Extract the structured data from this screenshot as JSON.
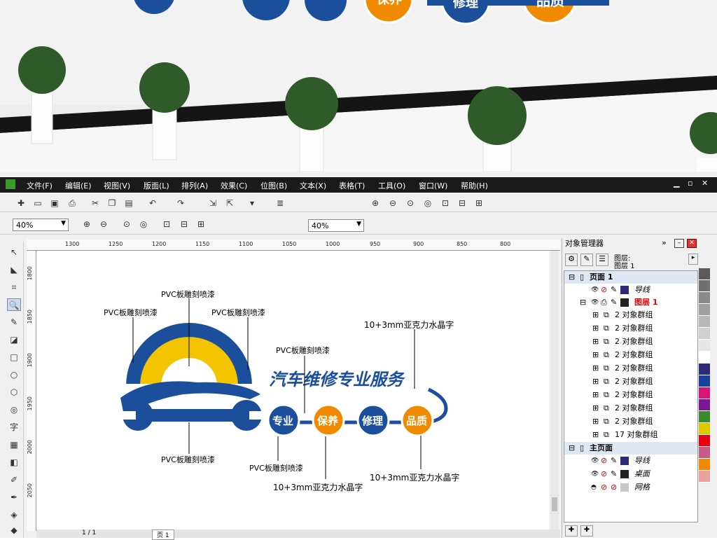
{
  "menu": [
    "文件(F)",
    "编辑(E)",
    "视图(V)",
    "版面(L)",
    "排列(A)",
    "效果(C)",
    "位图(B)",
    "文本(X)",
    "表格(T)",
    "工具(O)",
    "窗口(W)",
    "帮助(H)"
  ],
  "zoom1": "40%",
  "zoom2": "40%",
  "ruler_h": [
    "1300",
    "1250",
    "1200",
    "1150",
    "1100",
    "1050",
    "1000",
    "950",
    "900",
    "850",
    "800"
  ],
  "ruler_v": [
    "1800",
    "1850",
    "1900",
    "1950",
    "2000",
    "2050"
  ],
  "design": {
    "title": "汽车维修专业服务",
    "badges": [
      "专业",
      "保养",
      "修理",
      "品质"
    ],
    "labels": [
      "PVC板雕刻喷漆",
      "PVC板雕刻喷漆",
      "PVC板雕刻喷漆",
      "PVC板雕刻喷漆",
      "PVC板雕刻喷漆",
      "PVC板雕刻喷漆"
    ],
    "acrylic": [
      "10+3mm亚克力水晶字",
      "10+3mm亚克力水晶字",
      "10+3mm亚克力水晶字"
    ]
  },
  "photo_badges": [
    "保养",
    "修理",
    "品质"
  ],
  "panel": {
    "title": "对象管理器",
    "layer_label": "图层:",
    "layer_value": "图层 1",
    "page1": "页面 1",
    "guides": "导线",
    "layer1": "图层 1",
    "groups": [
      "2 对象群组",
      "2 对象群组",
      "2 对象群组",
      "2 对象群组",
      "2 对象群组",
      "2 对象群组",
      "2 对象群组",
      "2 对象群组",
      "2 对象群组",
      "17 对象群组"
    ],
    "master": "主页面",
    "m_guides": "导线",
    "m_desktop": "桌面",
    "m_grid": "网格"
  },
  "pagebar": {
    "count": "1 / 1",
    "tab": "页 1"
  },
  "palette": [
    "#5a5a5a",
    "#707070",
    "#8a8a8a",
    "#a0a0a0",
    "#b8b8b8",
    "#d0d0d0",
    "#e6e6e6",
    "#ffffff",
    "#2e2a7a",
    "#1c3f9a",
    "#d8147a",
    "#7a1a8e",
    "#3a8a2e",
    "#e0c800",
    "#e60012",
    "#c85a8a",
    "#f08a00",
    "#e9a0a0"
  ]
}
